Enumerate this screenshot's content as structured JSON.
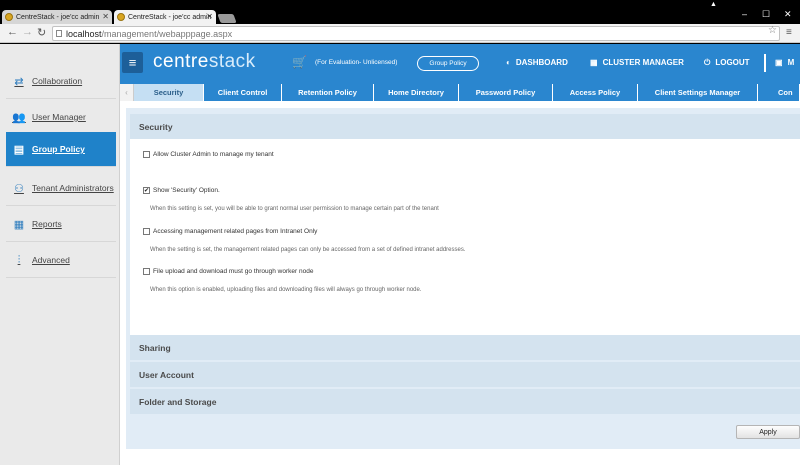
{
  "browser": {
    "tabs": [
      {
        "title": "CentreStack - joe'cc admin"
      },
      {
        "title": "CentreStack - joe'cc admin"
      }
    ],
    "url_host": "localhost",
    "url_path": "/management/webapppage.aspx"
  },
  "header": {
    "logo_main": "centre",
    "logo_light": "stack",
    "eval_text": "(For Evaluation- Unlicensed)",
    "group_policy_button": "Group Policy",
    "nav": [
      {
        "label": "DASHBOARD",
        "icon": "dashboard-icon"
      },
      {
        "label": "CLUSTER MANAGER",
        "icon": "server-icon"
      },
      {
        "label": "LOGOUT",
        "icon": "power-icon"
      },
      {
        "label": "M",
        "icon": "monitor-icon"
      }
    ]
  },
  "sidebar": {
    "items": [
      {
        "label": "Collaboration",
        "icon": "collaboration-icon"
      },
      {
        "label": "User Manager",
        "icon": "users-icon"
      },
      {
        "label": "Group Policy",
        "icon": "group-policy-icon",
        "active": true
      },
      {
        "label": "Tenant Administrators",
        "icon": "tenant-admin-icon"
      },
      {
        "label": "Reports",
        "icon": "reports-icon"
      },
      {
        "label": "Advanced",
        "icon": "advanced-icon"
      }
    ]
  },
  "policy_tabs": [
    {
      "label": "Security",
      "active": true
    },
    {
      "label": "Client Control"
    },
    {
      "label": "Retention Policy"
    },
    {
      "label": "Home Directory"
    },
    {
      "label": "Password Policy"
    },
    {
      "label": "Access Policy"
    },
    {
      "label": "Client Settings Manager"
    },
    {
      "label": "Con"
    }
  ],
  "security": {
    "title": "Security",
    "options": [
      {
        "label": "Allow Cluster Admin to manage my tenant",
        "checked": false,
        "description": ""
      },
      {
        "label": "Show 'Security' Option.",
        "checked": true,
        "description": "When this setting is set, you will be able to grant normal user permission to manage certain part of the tenant"
      },
      {
        "label": "Accessing management related pages from Intranet Only",
        "checked": false,
        "description": "When the setting is set, the management related pages can only be accessed from a set of defined intranet addresses."
      },
      {
        "label": "File upload and download must go through worker node",
        "checked": false,
        "description": "When this option is enabled, uploading files and downloading files will always go through worker node."
      }
    ]
  },
  "sections": [
    {
      "title": "Sharing"
    },
    {
      "title": "User Account"
    },
    {
      "title": "Folder and Storage"
    }
  ],
  "apply_button": "Apply",
  "colors": {
    "accent": "#2a86cf",
    "active_nav": "#1f82c9",
    "section_bg": "#d4e3ef"
  }
}
